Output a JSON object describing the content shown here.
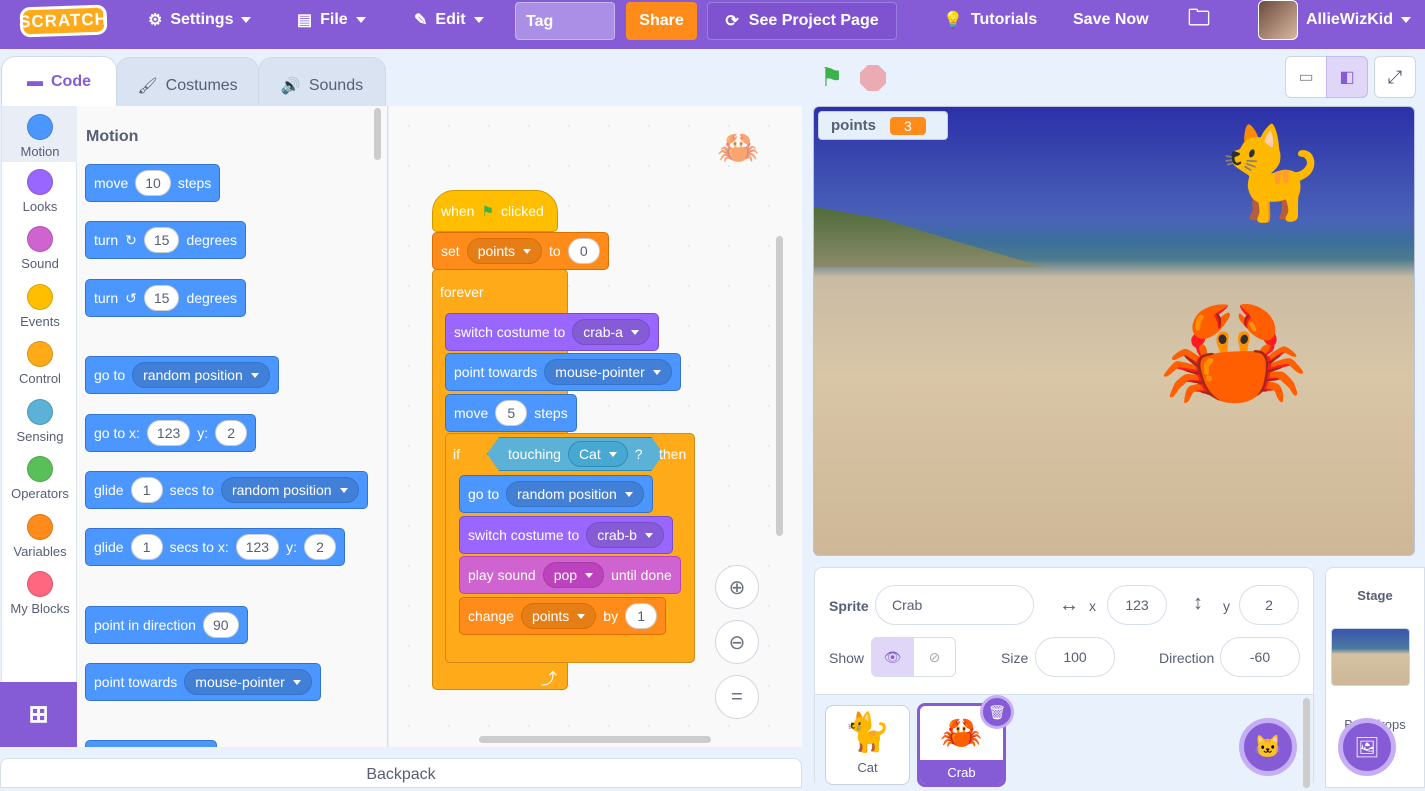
{
  "menubar": {
    "logo": "SCRATCH",
    "settings": "Settings",
    "file": "File",
    "edit": "Edit",
    "title_value": "Tag",
    "share": "Share",
    "see_project": "See Project Page",
    "tutorials": "Tutorials",
    "save_now": "Save Now",
    "username": "AllieWizKid",
    "bg_color": "#855cd6"
  },
  "tabs": [
    "Code",
    "Costumes",
    "Sounds"
  ],
  "categories": [
    {
      "label": "Motion",
      "color": "#4c97ff"
    },
    {
      "label": "Looks",
      "color": "#9966ff"
    },
    {
      "label": "Sound",
      "color": "#cf63cf"
    },
    {
      "label": "Events",
      "color": "#ffbf00"
    },
    {
      "label": "Control",
      "color": "#ffab19"
    },
    {
      "label": "Sensing",
      "color": "#5cb1d6"
    },
    {
      "label": "Operators",
      "color": "#59c059"
    },
    {
      "label": "Variables",
      "color": "#ff8c1a"
    },
    {
      "label": "My Blocks",
      "color": "#ff6680"
    }
  ],
  "palette": {
    "heading": "Motion",
    "move": {
      "a": "move",
      "n": "10",
      "b": "steps"
    },
    "turn_right": {
      "a": "turn",
      "n": "15",
      "b": "degrees"
    },
    "turn_left": {
      "a": "turn",
      "n": "15",
      "b": "degrees"
    },
    "goto": {
      "a": "go to",
      "opt": "random position"
    },
    "gotoxy": {
      "a": "go to x:",
      "x": "123",
      "b": "y:",
      "y": "2"
    },
    "glide": {
      "a": "glide",
      "n": "1",
      "b": "secs to",
      "opt": "random position"
    },
    "glidexy": {
      "a": "glide",
      "n": "1",
      "b": "secs to x:",
      "x": "123",
      "c": "y:",
      "y": "2"
    },
    "direction": {
      "a": "point in direction",
      "n": "90"
    },
    "towards": {
      "a": "point towards",
      "opt": "mouse-pointer"
    }
  },
  "script": {
    "hat": {
      "a": "when",
      "b": "clicked"
    },
    "set": {
      "a": "set",
      "var": "points",
      "b": "to",
      "val": "0"
    },
    "forever": "forever",
    "costume_a": {
      "a": "switch costume to",
      "opt": "crab-a"
    },
    "towards": {
      "a": "point towards",
      "opt": "mouse-pointer"
    },
    "move": {
      "a": "move",
      "n": "5",
      "b": "steps"
    },
    "if": {
      "a": "if",
      "b": "touching",
      "opt": "Cat",
      "q": "?",
      "c": "then"
    },
    "goto": {
      "a": "go to",
      "opt": "random position"
    },
    "costume_b": {
      "a": "switch costume to",
      "opt": "crab-b"
    },
    "sound": {
      "a": "play sound",
      "opt": "pop",
      "b": "until done"
    },
    "change": {
      "a": "change",
      "var": "points",
      "b": "by",
      "val": "1"
    }
  },
  "monitor": {
    "name": "points",
    "value": "3"
  },
  "sprite_info": {
    "sprite_label": "Sprite",
    "sprite_name": "Crab",
    "x_label": "x",
    "x": "123",
    "y_label": "y",
    "y": "2",
    "show_label": "Show",
    "size_label": "Size",
    "size": "100",
    "direction_label": "Direction",
    "direction": "-60"
  },
  "sprites": [
    {
      "name": "Cat",
      "selected": false
    },
    {
      "name": "Crab",
      "selected": true
    }
  ],
  "stage_pane": {
    "title": "Stage",
    "backdrops": "Backdrops"
  },
  "backpack": "Backpack"
}
